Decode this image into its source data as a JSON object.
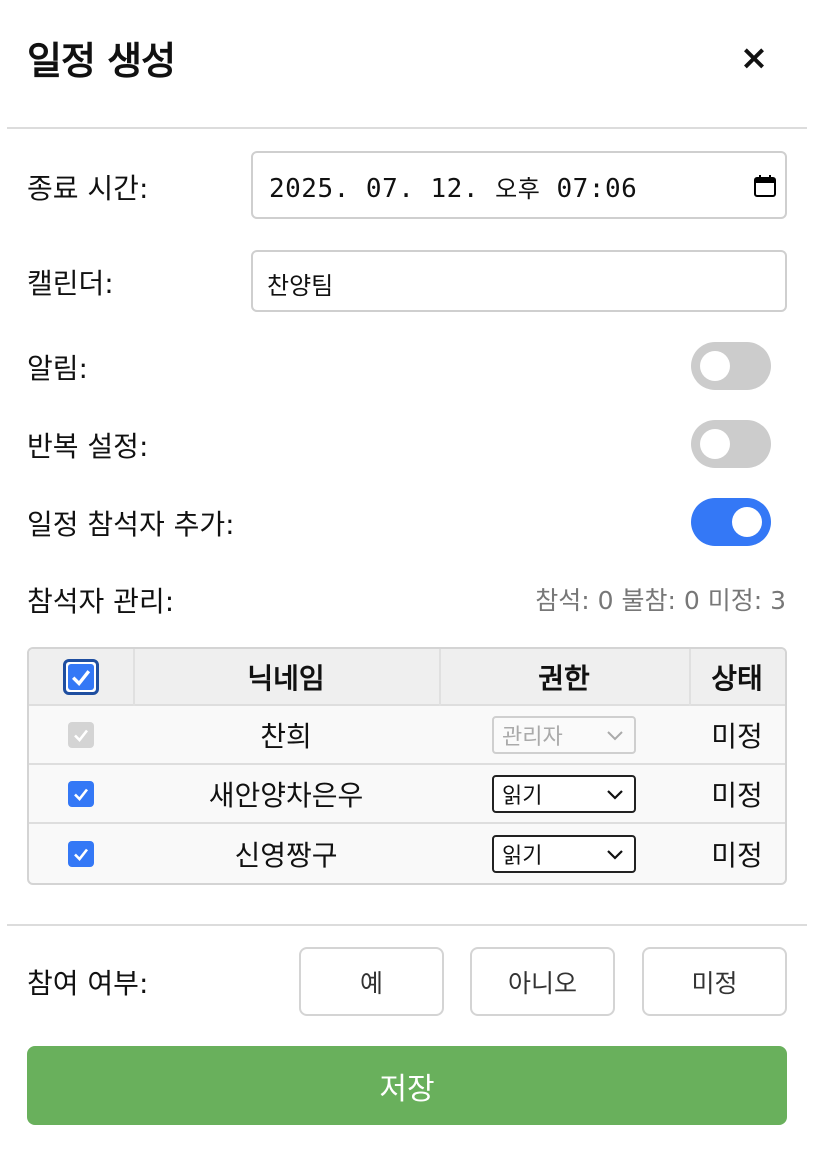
{
  "header": {
    "title": "일정 생성",
    "close_glyph": "×"
  },
  "form": {
    "end_time": {
      "label": "종료 시간:",
      "date": "2025. 07. 12.",
      "ampm": "오후",
      "time": "07:06",
      "icon": "calendar-icon"
    },
    "calendar": {
      "label": "캘린더:",
      "value": "찬양팀"
    },
    "alarm": {
      "label": "알림:",
      "on": false
    },
    "repeat": {
      "label": "반복 설정:",
      "on": false
    },
    "add_attendees": {
      "label": "일정 참석자 추가:",
      "on": true
    },
    "attendee_manage": {
      "label": "참석자 관리:",
      "counts": "참석: 0 불참: 0 미정: 3"
    }
  },
  "table": {
    "headers": {
      "nickname": "닉네임",
      "role": "권한",
      "status": "상태"
    },
    "header_checked": true,
    "rows": [
      {
        "checked": true,
        "disabled": true,
        "nickname": "찬희",
        "role": "관리자",
        "role_disabled": true,
        "status": "미정"
      },
      {
        "checked": true,
        "disabled": false,
        "nickname": "새안양차은우",
        "role": "읽기",
        "role_disabled": false,
        "status": "미정"
      },
      {
        "checked": true,
        "disabled": false,
        "nickname": "신영짱구",
        "role": "읽기",
        "role_disabled": false,
        "status": "미정"
      }
    ]
  },
  "attendance": {
    "label": "참여 여부:",
    "options": [
      "예",
      "아니오",
      "미정"
    ]
  },
  "save_label": "저장",
  "colors": {
    "accent": "#3478f6",
    "save": "#69b05c",
    "toggle_off": "#cccccc"
  }
}
